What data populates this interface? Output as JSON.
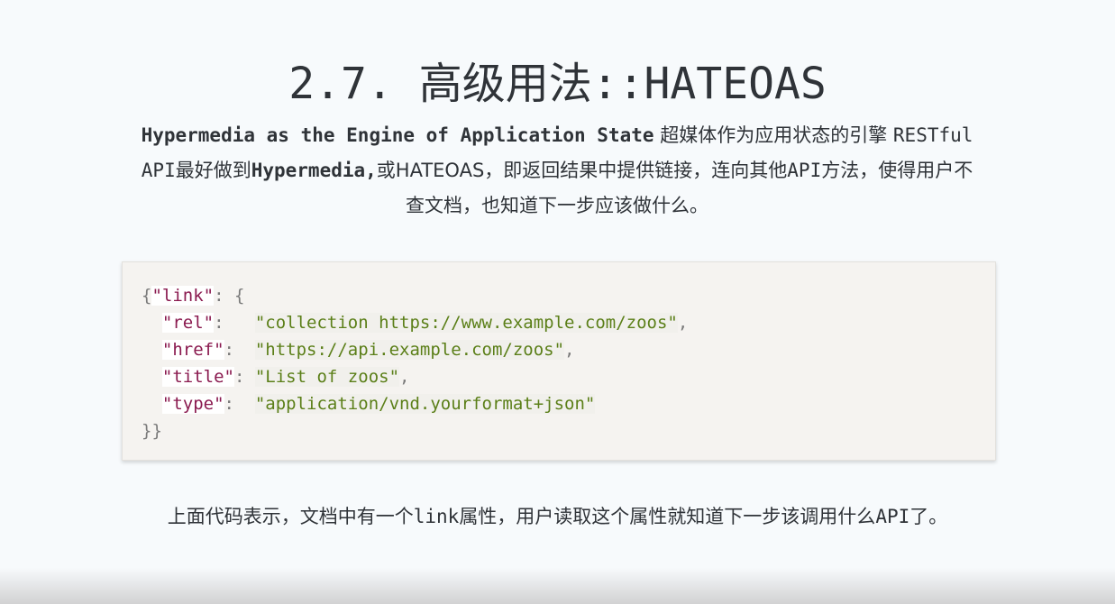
{
  "heading": {
    "title": "2.7. 高级用法::HATEOAS"
  },
  "intro": {
    "english": "Hypermedia as the Engine of Application State",
    "chinese_1": "超媒体作为应用状态的引擎",
    "restful": "RESTful",
    "api_1": "API",
    "chinese_2": "最好做到",
    "hypermedia": "Hypermedia,",
    "chinese_3": "或HATEOAS，即返回结果中提供链接，连向其他",
    "api_2": "API",
    "chinese_4": "方法，使得用户不",
    "chinese_5": "查文档，也知道下一步应该做什么。"
  },
  "code": {
    "open": "{",
    "link_key": "\"link\"",
    "colon_brace": ": {",
    "rel_key": "\"rel\"",
    "rel_sep": ":   ",
    "rel_value": "\"collection https://www.example.com/zoos\"",
    "comma_1": ",",
    "href_key": "\"href\"",
    "href_sep": ":  ",
    "href_value": "\"https://api.example.com/zoos\"",
    "comma_2": ",",
    "title_key": "\"title\"",
    "title_sep": ": ",
    "title_value": "\"List of zoos\"",
    "comma_3": ",",
    "type_key": "\"type\"",
    "type_sep": ":  ",
    "type_value": "\"application/vnd.yourformat+json\"",
    "close": "}}"
  },
  "after": {
    "part_1": "上面代码表示，文档中有一个",
    "link": "link",
    "part_2": "属性，用户读取这个属性就知道下一步该调用什么",
    "api": "API",
    "part_3": "了。"
  }
}
